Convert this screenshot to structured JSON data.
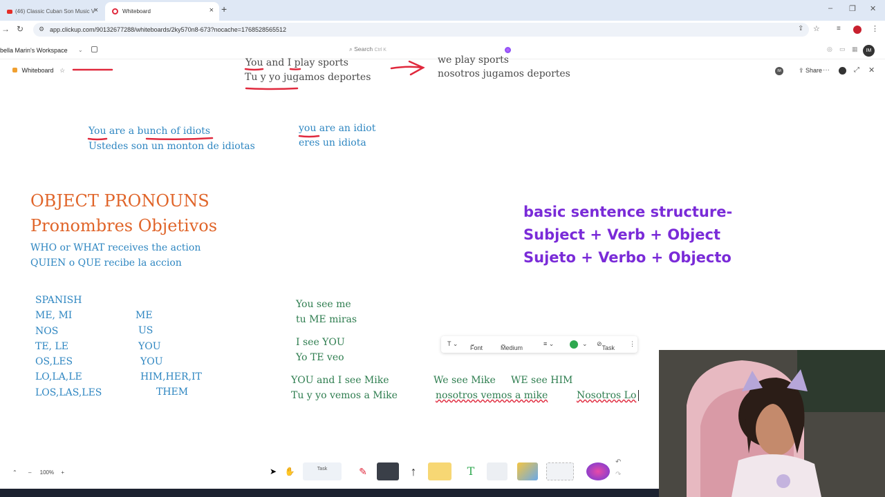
{
  "browser": {
    "tabs": [
      {
        "label": "(46) Classic Cuban Son Music V"
      },
      {
        "label": "Whiteboard"
      }
    ],
    "url": "app.clickup.com/90132677288/whiteboards/2ky570n8-673?nocache=1768528565512"
  },
  "app": {
    "workspace": "bella Marin's Workspace",
    "search_placeholder": "Search",
    "search_shortcut": "Ctrl K",
    "avatar": "IM"
  },
  "whiteboard": {
    "title": "Whiteboard",
    "share_label": "Share",
    "avatar": "IM"
  },
  "canvas": {
    "top_en": "You and I play sports",
    "top_es": "Tu y yo jugamos deportes",
    "we_en": "we play sports",
    "we_es": "nosotros jugamos deportes",
    "bunch_en": "You are a bunch of idiots",
    "bunch_es": "Ustedes son un monton de idiotas",
    "idiot_en": "you are an idiot",
    "idiot_es": "eres un idiota",
    "heading_en": "OBJECT PRONOUNS",
    "heading_es": "Pronombres Objetivos",
    "def_en": "WHO or WHAT receives the action",
    "def_es": "QUIEN o QUE recibe la accion",
    "structure": [
      "basic sentence structure-",
      "Subject + Verb + Object",
      "Sujeto + Verbo + Objecto"
    ],
    "spanish_col": [
      "SPANISH",
      "ME, MI",
      "NOS",
      "TE, LE",
      "OS,LES",
      "LO,LA,LE",
      "LOS,LAS,LES"
    ],
    "english_col": [
      "ME",
      "US",
      "YOU",
      "YOU",
      "HIM,HER,IT",
      "THEM"
    ],
    "ex1_en": "You see me",
    "ex1_es": "tu ME miras",
    "ex2_en": "I see YOU",
    "ex2_es": "Yo TE veo",
    "ex3_en": "YOU and I see Mike",
    "ex3_es": "Tu y yo vemos a Mike",
    "ex4_en": "We see Mike",
    "ex4_es": "nosotros vemos a mike",
    "ex5_en": "WE see HIM",
    "ex5_es": "Nosotros Lo"
  },
  "format_toolbar": {
    "font_label": "Font",
    "size_label": "Medium",
    "task_label": "Task",
    "text_color": "#2ea84f"
  },
  "dock": {
    "task_label": "Task"
  },
  "zoom": {
    "level": "100%"
  },
  "colors": {
    "green_text": "#2e7d4f",
    "blue_text": "#2e86c1",
    "orange_heading": "#e0652a",
    "purple_text": "#7a2bd8",
    "red_marker": "#e0283c"
  }
}
